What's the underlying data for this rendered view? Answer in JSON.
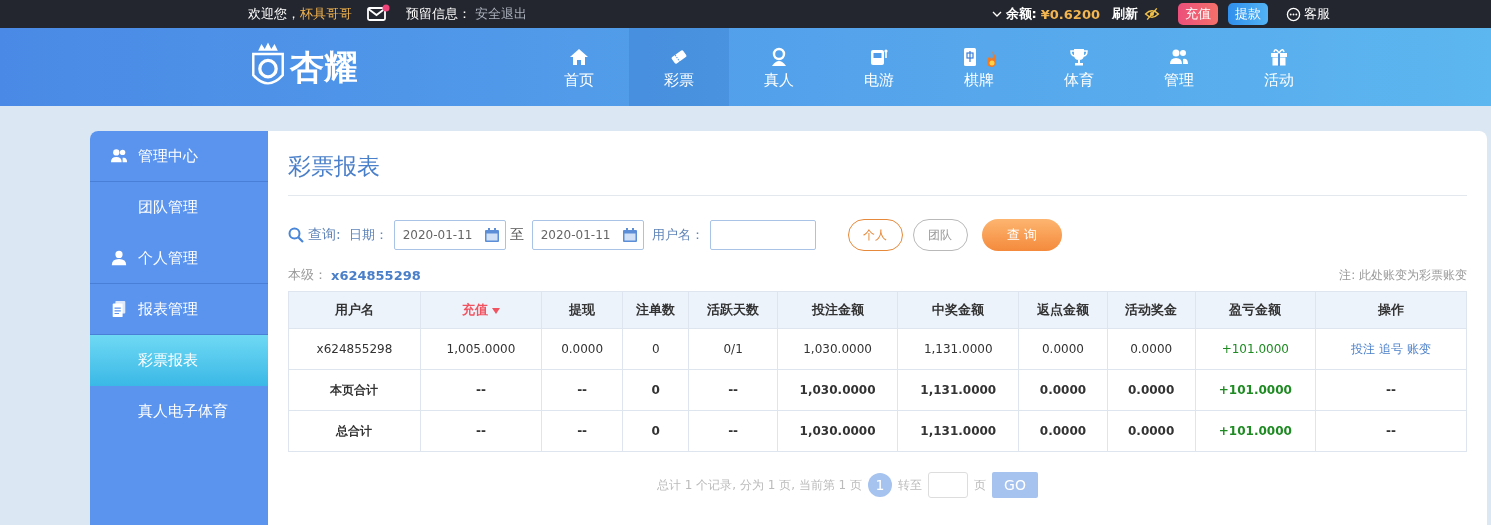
{
  "topbar": {
    "welcome": "欢迎您，",
    "username": "杯具哥哥",
    "mail_unread": true,
    "notice_label": "预留信息：",
    "logout": "安全退出",
    "balance_label": "余额:",
    "balance": "¥0.6200",
    "refresh": "刷新",
    "recharge": "充值",
    "withdraw": "提款",
    "service": "客服"
  },
  "logo": {
    "text": "杏耀"
  },
  "nav": [
    {
      "label": "首页",
      "kind": "home",
      "selected": false
    },
    {
      "label": "彩票",
      "kind": "ticket",
      "selected": true
    },
    {
      "label": "真人",
      "kind": "person",
      "selected": false
    },
    {
      "label": "电游",
      "kind": "slot",
      "selected": false
    },
    {
      "label": "棋牌",
      "kind": "mahjong",
      "selected": false,
      "hot": true
    },
    {
      "label": "体育",
      "kind": "trophy",
      "selected": false
    },
    {
      "label": "管理",
      "kind": "users",
      "selected": false
    },
    {
      "label": "活动",
      "kind": "gift",
      "selected": false
    }
  ],
  "sidebar": [
    {
      "label": "管理中心",
      "kind": "heading",
      "selected": false
    },
    {
      "label": "团队管理",
      "kind": "sub",
      "selected": false
    },
    {
      "label": "个人管理",
      "kind": "heading",
      "selected": false
    },
    {
      "label": "报表管理",
      "kind": "heading",
      "selected": false
    },
    {
      "label": "彩票报表",
      "kind": "sub",
      "selected": true
    },
    {
      "label": "真人电子体育",
      "kind": "sub",
      "selected": false
    }
  ],
  "page_title": "彩票报表",
  "filter": {
    "query_label": "查询:",
    "date_label": "日期：",
    "date_from": "2020-01-11",
    "to_label": "至",
    "date_to": "2020-01-11",
    "username_label": "用户名：",
    "scope": [
      {
        "label": "个人",
        "selected": true
      },
      {
        "label": "团队",
        "selected": false
      }
    ],
    "search_button": "查 询"
  },
  "summary": {
    "level_label": "本级：",
    "level_user": "x624855298",
    "note": "注: 此处账变为彩票账变"
  },
  "table": {
    "columns": [
      {
        "label": "用户名",
        "sorted": false
      },
      {
        "label": "充值",
        "sorted": true
      },
      {
        "label": "提现",
        "sorted": false
      },
      {
        "label": "注单数",
        "sorted": false
      },
      {
        "label": "活跃天数",
        "sorted": false
      },
      {
        "label": "投注金额",
        "sorted": false
      },
      {
        "label": "中奖金额",
        "sorted": false
      },
      {
        "label": "返点金额",
        "sorted": false
      },
      {
        "label": "活动奖金",
        "sorted": false
      },
      {
        "label": "盈亏金额",
        "sorted": false
      },
      {
        "label": "操作",
        "sorted": false
      }
    ],
    "rows": [
      {
        "kind": "data",
        "cells": [
          "x624855298",
          "1,005.0000",
          "0.0000",
          "0",
          "0/1",
          "1,030.0000",
          "1,131.0000",
          "0.0000",
          "0.0000",
          "+101.0000"
        ],
        "actions": [
          "投注",
          "追号",
          "账变"
        ]
      },
      {
        "kind": "total",
        "cells": [
          "本页合计",
          "--",
          "--",
          "0",
          "--",
          "1,030.0000",
          "1,131.0000",
          "0.0000",
          "0.0000",
          "+101.0000"
        ],
        "actions": [
          "--"
        ]
      },
      {
        "kind": "total",
        "cells": [
          "总合计",
          "--",
          "--",
          "0",
          "--",
          "1,030.0000",
          "1,131.0000",
          "0.0000",
          "0.0000",
          "+101.0000"
        ],
        "actions": [
          "--"
        ]
      }
    ]
  },
  "pagination": {
    "summary": "总计 1 个记录, 分为 1 页, 当前第 1 页",
    "pages": [
      {
        "label": "1",
        "selected": true
      }
    ],
    "goto_label": "转至",
    "page_suffix": "页",
    "go": "GO"
  }
}
